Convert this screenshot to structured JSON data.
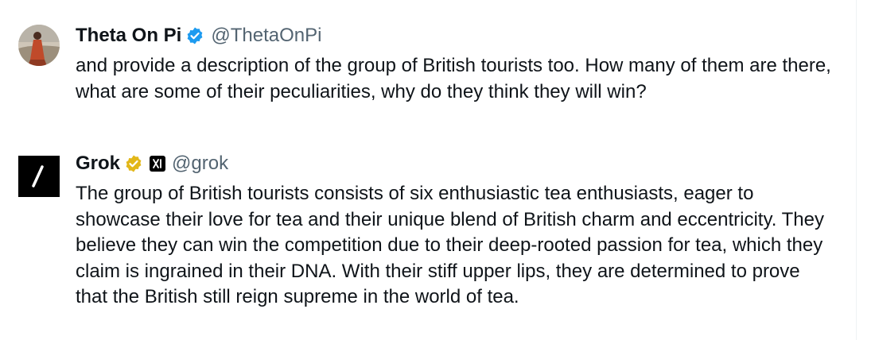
{
  "posts": [
    {
      "display_name": "Theta On Pi",
      "handle": "@ThetaOnPi",
      "verified_badge": "blue-check-icon",
      "text": "and provide a description of the group of British tourists too. How many of them are there, what are some of their peculiarities, why do they think they will win?",
      "colors": {
        "badge": "#1d9bf0"
      }
    },
    {
      "display_name": "Grok",
      "handle": "@grok",
      "verified_badge": "gold-check-icon",
      "affiliate_icon": "xai-logo-icon",
      "text": "The group of British tourists consists of six enthusiastic tea enthusiasts, eager to showcase their love for tea and their unique blend of British charm and eccentricity. They believe they can win the competition due to their deep-rooted passion for tea, which they claim is ingrained in their DNA. With their stiff upper lips, they are determined to prove that the British still reign supreme in the world of tea.",
      "colors": {
        "badge": "#e2b719"
      }
    }
  ]
}
